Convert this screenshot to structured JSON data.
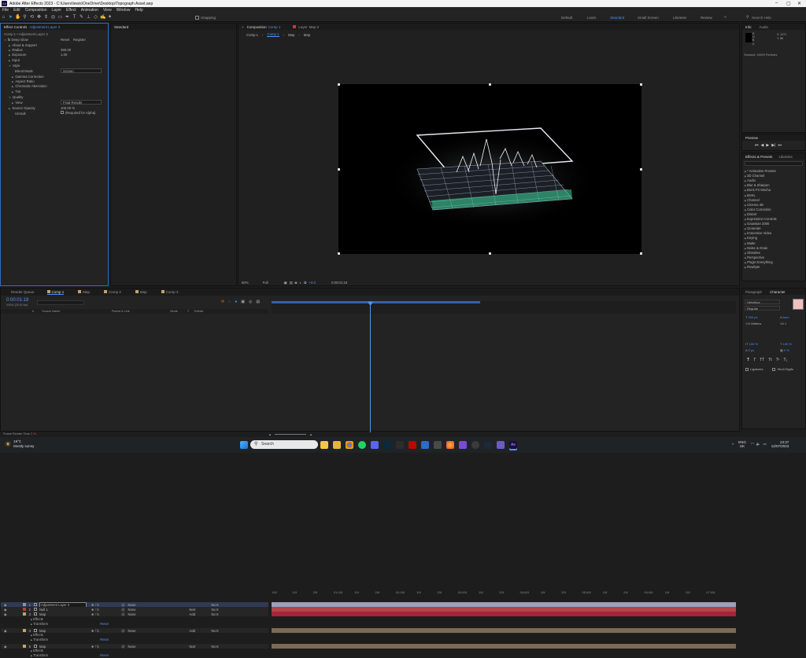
{
  "app": {
    "title": "Adobe After Effects 2023 - C:\\Users\\lewis\\OneDrive\\Desktop\\Topograph Asset.aep"
  },
  "menu": [
    "File",
    "Edit",
    "Composition",
    "Layer",
    "Effect",
    "Animation",
    "View",
    "Window",
    "Help"
  ],
  "toolbar": {
    "snapping": "Snapping",
    "workspaces": [
      "Default",
      "Learn",
      "Standard",
      "Small Screen",
      "Libraries",
      "Review"
    ],
    "active_workspace": "Standard",
    "search_placeholder": "Search Help"
  },
  "effect_controls": {
    "tab": "Effect Controls",
    "tab_layer": "Adjustment Layer 3",
    "breadcrumb": "Comp 1 • Adjustment Layer 3",
    "effect_name": "Deep Glow",
    "reset": "Reset",
    "register": "Register",
    "rows": [
      {
        "label": "About & Support",
        "value": ""
      },
      {
        "label": "Radius",
        "value": "390.00"
      },
      {
        "label": "Exposure",
        "value": "1.00"
      },
      {
        "label": "Input",
        "value": ""
      },
      {
        "label": "Style",
        "value": ""
      },
      {
        "label": "Blend Mode",
        "value": "Screen"
      },
      {
        "label": "Gamma Correction",
        "value": ""
      },
      {
        "label": "Aspect Ratio",
        "value": ""
      },
      {
        "label": "Chromatic Aberration",
        "value": ""
      },
      {
        "label": "Tint",
        "value": ""
      },
      {
        "label": "Quality",
        "value": ""
      },
      {
        "label": "View",
        "value": "Final Render"
      },
      {
        "label": "Source Opacity",
        "value": "100.00 %"
      },
      {
        "label": "Unmult",
        "value": "(Required for Alpha)"
      }
    ]
  },
  "standard_tab": "Standard",
  "composition": {
    "tab": "Composition",
    "tab_comp": "Comp 1",
    "layer_tab": "Layer",
    "layer_tab_name": "Map 2",
    "nav": [
      "Comp 1",
      "Comp 1",
      "Map",
      "Map"
    ],
    "zoom": "50%",
    "resolution": "Full",
    "time": "0;00;01;18",
    "plus": "+0.0"
  },
  "info": {
    "tab": "Info",
    "audio_tab": "Audio",
    "letters": [
      "R",
      "G",
      "B",
      "A"
    ],
    "coords": [
      "X: 1271",
      "Y: 86"
    ],
    "status": "Stardust: 15899 Particles"
  },
  "preview": {
    "tab": "Preview"
  },
  "effects_presets": {
    "tab": "Effects & Presets",
    "libraries": "Libraries",
    "search_placeholder": "",
    "items": [
      "* Animation Presets",
      "3D Channel",
      "Audio",
      "Blur & Sharpen",
      "Boris FX Mocha",
      "BSKL",
      "Channel",
      "Cinema 4D",
      "Color Correction",
      "Distort",
      "Expression Controls",
      "Gaussian 2000",
      "Generate",
      "Immersive Video",
      "Keying",
      "Matte",
      "Noise & Grain",
      "Obsolete",
      "Perspective",
      "Plugin Everything",
      "Rowbyte"
    ]
  },
  "character": {
    "tab": "Character",
    "paragraph_tab": "Paragraph",
    "font": "Helvetica",
    "style": "Regular",
    "size": "300 px",
    "leading": "Auto",
    "kerning": "Metrics",
    "tracking": "0",
    "vscale": "100 %",
    "hscale": "100 %",
    "baseline": "0 px",
    "tsume": "0 %",
    "ligatures": "Ligatures",
    "hindi": "Hindi Digits",
    "swatch": "#f0c0c0"
  },
  "timeline": {
    "tabs": [
      "Render Queue",
      "Comp 1",
      "Map",
      "Comp 2",
      "Map",
      "Comp 3"
    ],
    "active_tab": "Comp 1",
    "timecode": "0:00:01:18",
    "fps": "00044 (25.00 fps)",
    "headers": [
      "#",
      "Source Name",
      "Mode",
      "T",
      "TrkMat",
      "Parent & Link"
    ],
    "ruler": [
      ":00f",
      "10f",
      "20f",
      "01:00f",
      "10f",
      "20f",
      "02:00f",
      "10f",
      "20f",
      "03:00f",
      "10f",
      "20f",
      "04:00f",
      "10f",
      "20f",
      "05:00f",
      "10f",
      "20f",
      "06:00f",
      "10f",
      "20f",
      "07:00f"
    ],
    "layers": [
      {
        "num": "1",
        "name": "Adjustment Layer 3",
        "mode": "",
        "parent": "None",
        "trk": "No K",
        "label": "#8f8fb5",
        "bar": "#9aa0c0"
      },
      {
        "num": "2",
        "name": "Null 1",
        "mode": "Norr",
        "parent": "None",
        "trk": "No K",
        "label": "#c23a3a",
        "bar": "#b24444"
      },
      {
        "num": "3",
        "name": "Map",
        "mode": "Add",
        "parent": "None",
        "trk": "No K",
        "label": "#c8a264",
        "bar": "#a5243a"
      },
      {
        "num": "4",
        "name": "Map",
        "mode": "Add",
        "parent": "None",
        "trk": "No K",
        "label": "#c8a264",
        "bar": "#7b6b55"
      },
      {
        "num": "5",
        "name": "Map",
        "mode": "Norr",
        "parent": "None",
        "trk": "No K",
        "label": "#c8a264",
        "bar": "#7b6b55"
      }
    ],
    "sub": {
      "effects": "Effects",
      "transform": "Transform",
      "reset": "Reset"
    },
    "frame_render": "Frame Render Time",
    "frame_render_value": "2.7s"
  },
  "taskbar": {
    "search": "Search",
    "weather_temp": "19°C",
    "weather_text": "Mostly sunny",
    "lang1": "ENG",
    "lang2": "UK",
    "time": "23:37",
    "date": "12/07/2023"
  }
}
